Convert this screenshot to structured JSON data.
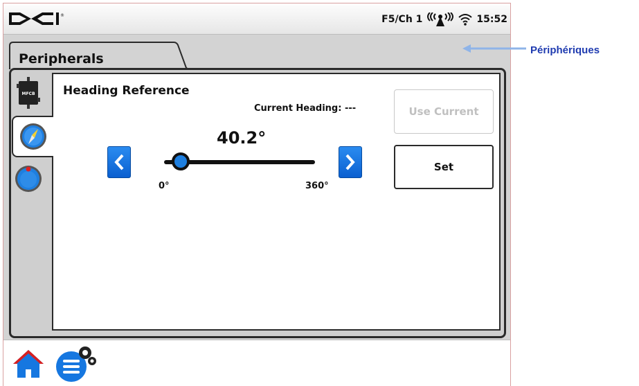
{
  "statusbar": {
    "logo": "DCI",
    "channel": "F5/Ch 1",
    "time": "15:52",
    "icons": [
      "antenna-signal-icon",
      "wifi-icon"
    ]
  },
  "tab": {
    "title": "Peripherals"
  },
  "side_tabs": [
    {
      "name": "mfcb",
      "label": "MFCB",
      "icon": "mfcb-device-icon"
    },
    {
      "name": "compass",
      "icon": "compass-icon"
    },
    {
      "name": "dial",
      "icon": "dial-gauge-icon"
    }
  ],
  "heading": {
    "title": "Heading Reference",
    "current_label": "Current Heading: ---",
    "value": "40.2°",
    "slider_value": 40.2,
    "slider_min_label": "0°",
    "slider_max_label": "360°",
    "slider_min": 0,
    "slider_max": 360
  },
  "buttons": {
    "use_current": "Use Current",
    "set": "Set"
  },
  "bottom": {
    "icons": [
      "home-icon",
      "settings-menu-icon"
    ]
  },
  "annotation": {
    "text": "Périphériques"
  },
  "colors": {
    "accent_blue": "#1677e0",
    "annotation": "#1f3bb0"
  }
}
